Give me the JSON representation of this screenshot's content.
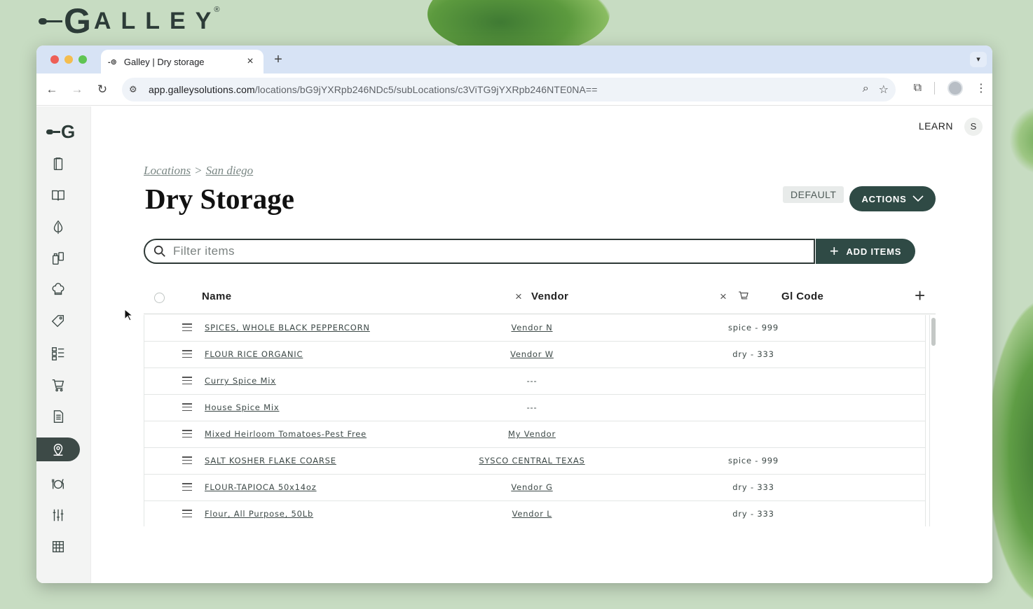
{
  "brand": {
    "logo_letter": "G",
    "logo_text": "ALLEY",
    "registered": "®"
  },
  "browser": {
    "tab_title": "Galley | Dry storage",
    "tab_favicon": "-⊚",
    "url_host": "app.galleysolutions.com",
    "url_path": "/locations/bG9jYXRpb246NDc5/subLocations/c3ViTG9jYXRpb246NTE0NA=="
  },
  "sidebar": {
    "logo_letter": "G",
    "items": [
      {
        "name": "ingredients",
        "icon": "clipboard-icon"
      },
      {
        "name": "recipes",
        "icon": "book-icon"
      },
      {
        "name": "produce",
        "icon": "onion-icon"
      },
      {
        "name": "inventory",
        "icon": "containers-icon"
      },
      {
        "name": "menus",
        "icon": "chef-hat-icon"
      },
      {
        "name": "pricing",
        "icon": "tag-icon"
      },
      {
        "name": "checklists",
        "icon": "checklist-icon"
      },
      {
        "name": "ordering",
        "icon": "cart-icon"
      },
      {
        "name": "reports",
        "icon": "document-icon"
      },
      {
        "name": "locations",
        "icon": "location-pin-icon",
        "active": true
      },
      {
        "name": "service",
        "icon": "dining-icon"
      },
      {
        "name": "settings",
        "icon": "sliders-icon"
      },
      {
        "name": "calendar",
        "icon": "grid-calendar-icon"
      }
    ]
  },
  "header": {
    "learn_label": "LEARN",
    "user_initial": "S"
  },
  "breadcrumb": {
    "root": "Locations",
    "separator": ">",
    "current": "San diego"
  },
  "page": {
    "title": "Dry Storage",
    "badge": "DEFAULT",
    "actions_label": "ACTIONS"
  },
  "filter": {
    "placeholder": "Filter items",
    "add_label": "ADD ITEMS"
  },
  "table": {
    "columns": {
      "name": "Name",
      "vendor": "Vendor",
      "gl_code": "Gl Code"
    },
    "rows": [
      {
        "name": "SPICES, WHOLE BLACK PEPPERCORN",
        "vendor": "Vendor N",
        "gl": "spice - 999"
      },
      {
        "name": "FLOUR RICE ORGANIC",
        "vendor": "Vendor W",
        "gl": "dry - 333"
      },
      {
        "name": "Curry Spice Mix",
        "vendor": "---",
        "gl": ""
      },
      {
        "name": "House Spice Mix",
        "vendor": "---",
        "gl": ""
      },
      {
        "name": "Mixed Heirloom Tomatoes-Pest Free",
        "vendor": "My Vendor",
        "gl": ""
      },
      {
        "name": "SALT KOSHER FLAKE COARSE",
        "vendor": "SYSCO CENTRAL TEXAS",
        "gl": "spice - 999"
      },
      {
        "name": "FLOUR-TAPIOCA 50x14oz",
        "vendor": "Vendor G",
        "gl": "dry - 333"
      },
      {
        "name": "Flour, All Purpose, 50Lb",
        "vendor": "Vendor L",
        "gl": "dry - 333"
      }
    ]
  },
  "colors": {
    "primary": "#2f4a45",
    "sidebar_active": "#3d4a47",
    "background": "#c7dcc2"
  }
}
